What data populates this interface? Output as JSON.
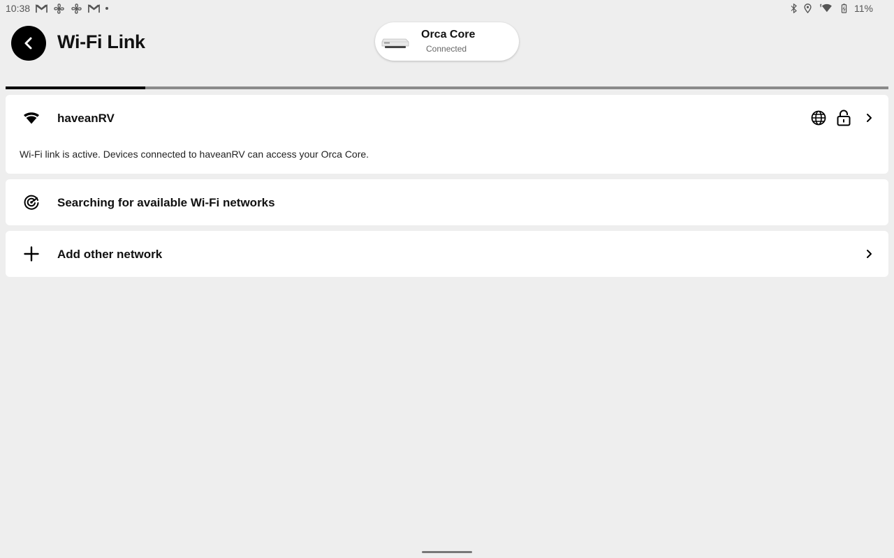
{
  "status_bar": {
    "time": "10:38",
    "battery": "11%",
    "left_icons": [
      "gmail-icon",
      "fan-icon",
      "fan-icon",
      "gmail-icon",
      "dot-icon"
    ],
    "right_icons": [
      "bluetooth-icon",
      "location-icon",
      "wifi-icon",
      "battery-icon"
    ]
  },
  "header": {
    "title": "Wi-Fi Link",
    "back_icon": "chevron-left-icon"
  },
  "device": {
    "name": "Orca Core",
    "status": "Connected"
  },
  "progress": {
    "fraction": 0.158
  },
  "wifi_network": {
    "ssid": "haveanRV",
    "description": "Wi-Fi link is active. Devices connected to haveanRV can access your Orca Core.",
    "icons": [
      "wifi-icon",
      "globe-icon",
      "lock-icon",
      "chevron-right-icon"
    ]
  },
  "searching": {
    "label": "Searching for available Wi-Fi networks",
    "icon": "radar-icon"
  },
  "add_network": {
    "label": "Add other network",
    "icon": "plus-icon"
  },
  "colors": {
    "background": "#eeeeee",
    "card": "#ffffff",
    "accent": "#000000",
    "track": "#8a8a8a"
  }
}
